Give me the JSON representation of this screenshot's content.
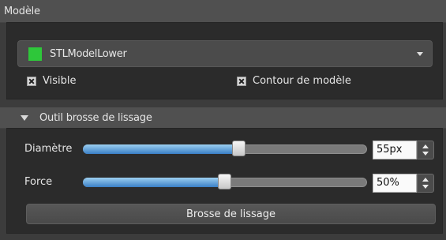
{
  "model_section": {
    "title": "Modèle",
    "dropdown": {
      "selected": "STLModelLower",
      "swatch_color": "#2ec73a",
      "caret_icon": "chevron-down-icon"
    },
    "checkboxes": {
      "visible": {
        "label": "Visible",
        "checked": true
      },
      "contour": {
        "label": "Contour de modèle",
        "checked": true
      }
    }
  },
  "tool_section": {
    "title": "Outil brosse de lissage",
    "collapse_icon": "triangle-down-icon",
    "diameter": {
      "label": "Diamètre",
      "value": "55px",
      "fraction": 0.55
    },
    "force": {
      "label": "Force",
      "value": "50%",
      "fraction": 0.5
    },
    "action_button": "Brosse de lissage"
  },
  "colors": {
    "background": "#3c3c3c",
    "panel": "#2b2b2b",
    "header": "#505050",
    "slider_fill": "#3a7fc6"
  }
}
